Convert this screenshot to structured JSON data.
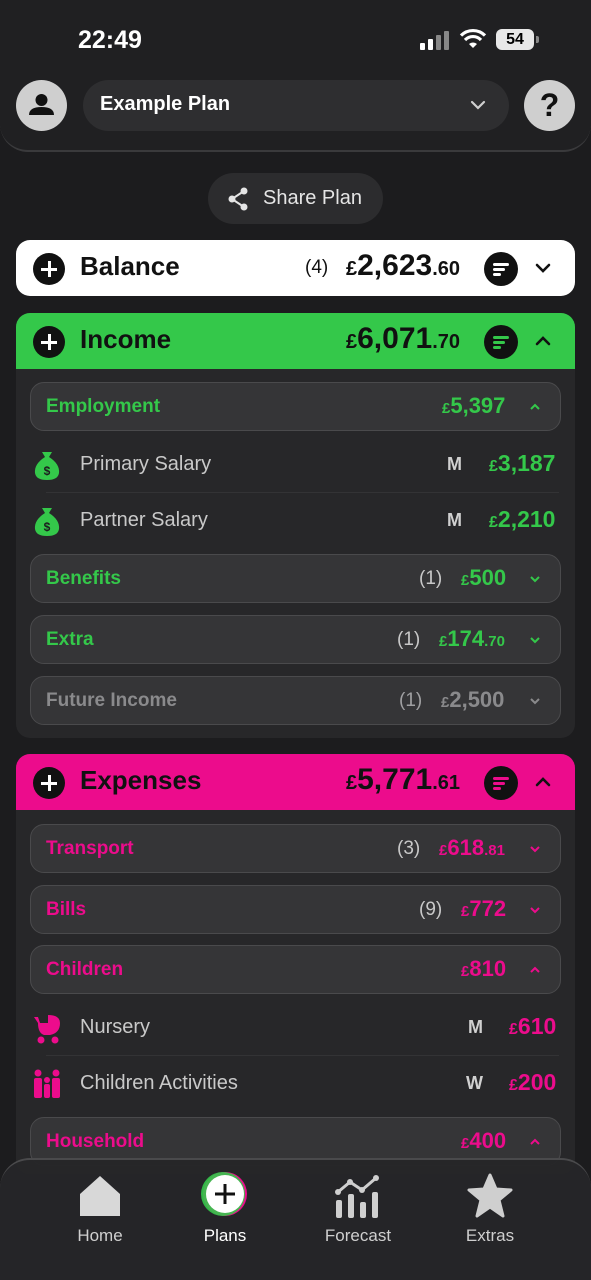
{
  "status": {
    "time": "22:49",
    "battery": "54"
  },
  "header": {
    "plan_name": "Example Plan",
    "help_label": "?"
  },
  "share": {
    "label": "Share Plan"
  },
  "balance": {
    "title": "Balance",
    "count": "(4)",
    "currency": "£",
    "amount_int": "2,623",
    "amount_dec": ".60"
  },
  "income": {
    "title": "Income",
    "currency": "£",
    "amount_int": "6,071",
    "amount_dec": ".70",
    "groups": {
      "employment": {
        "label": "Employment",
        "currency": "£",
        "amount_int": "5,397"
      },
      "benefits": {
        "label": "Benefits",
        "count": "(1)",
        "currency": "£",
        "amount_int": "500"
      },
      "extra": {
        "label": "Extra",
        "count": "(1)",
        "currency": "£",
        "amount_int": "174",
        "amount_dec": ".70"
      },
      "future": {
        "label": "Future Income",
        "count": "(1)",
        "currency": "£",
        "amount_int": "2,500"
      }
    },
    "items": [
      {
        "label": "Primary Salary",
        "freq": "M",
        "currency": "£",
        "amount": "3,187"
      },
      {
        "label": "Partner Salary",
        "freq": "M",
        "currency": "£",
        "amount": "2,210"
      }
    ]
  },
  "expenses": {
    "title": "Expenses",
    "currency": "£",
    "amount_int": "5,771",
    "amount_dec": ".61",
    "groups": {
      "transport": {
        "label": "Transport",
        "count": "(3)",
        "currency": "£",
        "amount_int": "618",
        "amount_dec": ".81"
      },
      "bills": {
        "label": "Bills",
        "count": "(9)",
        "currency": "£",
        "amount_int": "772"
      },
      "children": {
        "label": "Children",
        "currency": "£",
        "amount_int": "810"
      },
      "household": {
        "label": "Household",
        "currency": "£",
        "amount_int": "400"
      }
    },
    "items": [
      {
        "label": "Nursery",
        "freq": "M",
        "currency": "£",
        "amount": "610"
      },
      {
        "label": "Children Activities",
        "freq": "W",
        "currency": "£",
        "amount": "200"
      }
    ]
  },
  "nav": {
    "home": "Home",
    "plans": "Plans",
    "forecast": "Forecast",
    "extras": "Extras"
  },
  "colors": {
    "income": "#34c84a",
    "expense": "#ec0c8c",
    "future": "#8a8a8c"
  }
}
